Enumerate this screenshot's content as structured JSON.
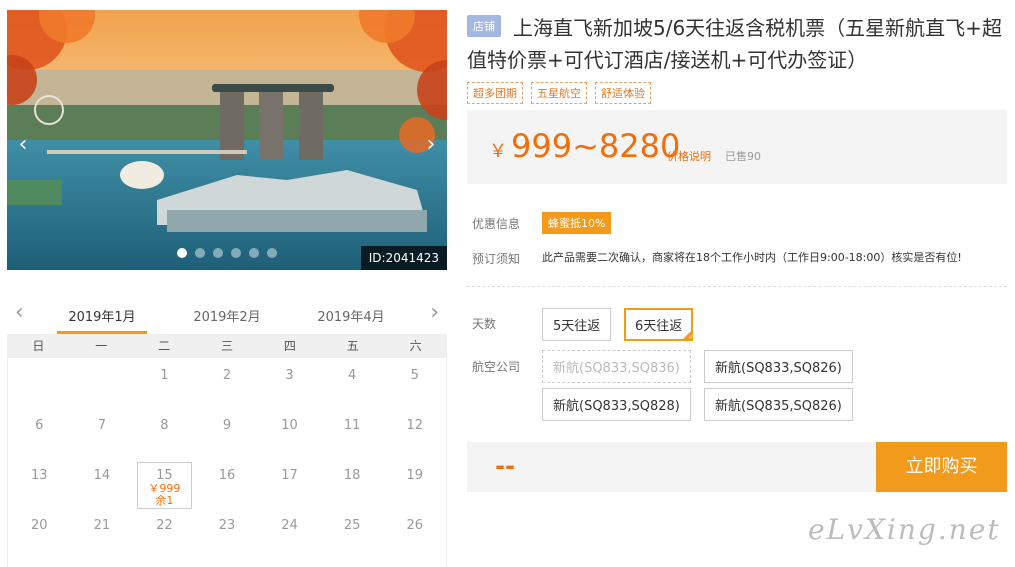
{
  "hero": {
    "id_label": "ID:2041423",
    "slide_count": 6,
    "active_slide": 0,
    "prev_symbol": "‹",
    "next_symbol": "›"
  },
  "calendar": {
    "prev_symbol": "‹",
    "next_symbol": "›",
    "months": [
      "2019年1月",
      "2019年2月",
      "2019年4月"
    ],
    "active_month": 0,
    "weekdays": [
      "日",
      "一",
      "二",
      "三",
      "四",
      "五",
      "六"
    ],
    "cells": [
      "",
      "",
      "1",
      "2",
      "3",
      "4",
      "5",
      "6",
      "7",
      "8",
      "9",
      "10",
      "11",
      "12",
      "13",
      "14",
      "15",
      "16",
      "17",
      "18",
      "19",
      "20",
      "21",
      "22",
      "23",
      "24",
      "25",
      "26"
    ],
    "selected_day": {
      "day": "15",
      "price": "￥999",
      "stock": "余1"
    }
  },
  "product": {
    "shop_tag": "店铺",
    "title": "上海直飞新加坡5/6天往返含税机票（五星新航直飞+超值特价票+可代订酒店/接送机+可代办签证）",
    "tags": [
      "超多团期",
      "五星航空",
      "舒适体验"
    ],
    "price_currency": "￥",
    "price_range": "999~8280",
    "price_explain": "价格说明",
    "sold": "已售90",
    "discount_label": "优惠信息",
    "discount_badge": "蜂蜜抵10%",
    "notice_label": "预订须知",
    "notice_text": "此产品需要二次确认，商家将在18个工作小时内（工作日9:00-18:00）核实是否有位!",
    "days_label": "天数",
    "day_options": [
      "5天往返",
      "6天往返"
    ],
    "active_day_option": 1,
    "airline_label": "航空公司",
    "airline_options": [
      "新航(SQ833,SQ836)",
      "新航(SQ833,SQ826)",
      "新航(SQ833,SQ828)",
      "新航(SQ835,SQ826)"
    ],
    "disabled_airline_option": 0,
    "buy_price": "--",
    "buy_button": "立即购买"
  },
  "watermark": "eLvXing.net",
  "colors": {
    "accent": "#f29a1c",
    "price": "#f26e0b",
    "shop_tag": "#a4b7e0"
  }
}
